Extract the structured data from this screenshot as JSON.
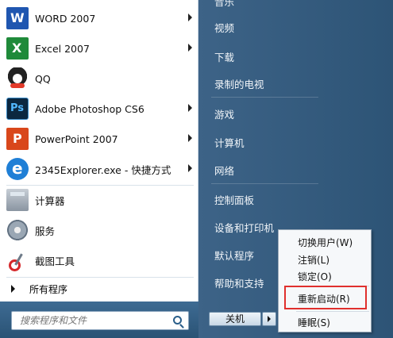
{
  "programs": [
    {
      "label": "WORD 2007",
      "icon": "word-icon",
      "has_submenu": true
    },
    {
      "label": "Excel 2007",
      "icon": "excel-icon",
      "has_submenu": true
    },
    {
      "label": "QQ",
      "icon": "qq-icon",
      "has_submenu": false
    },
    {
      "label": "Adobe Photoshop CS6",
      "icon": "photoshop-icon",
      "has_submenu": true
    },
    {
      "label": "PowerPoint 2007",
      "icon": "powerpoint-icon",
      "has_submenu": true
    },
    {
      "label": "2345Explorer.exe - 快捷方式",
      "icon": "browser-icon",
      "has_submenu": true
    },
    {
      "label": "计算器",
      "icon": "calculator-icon",
      "has_submenu": false
    },
    {
      "label": "服务",
      "icon": "services-icon",
      "has_submenu": false
    },
    {
      "label": "截图工具",
      "icon": "snipping-tool-icon",
      "has_submenu": false
    }
  ],
  "all_programs": "所有程序",
  "search": {
    "placeholder": "搜索程序和文件"
  },
  "right_links": [
    "音乐",
    "视频",
    "下载",
    "录制的电视",
    "游戏",
    "计算机",
    "网络",
    "控制面板",
    "设备和打印机",
    "默认程序",
    "帮助和支持"
  ],
  "shutdown": {
    "label": "关机"
  },
  "power_menu": [
    "切换用户(W)",
    "注销(L)",
    "锁定(O)",
    "重新启动(R)",
    "睡眠(S)"
  ],
  "highlight_color": "#e0302d"
}
